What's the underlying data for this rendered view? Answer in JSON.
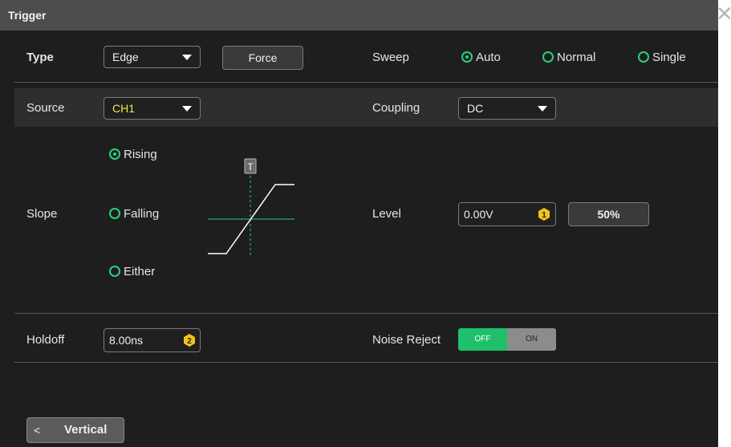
{
  "dialog": {
    "title": "Trigger",
    "close_icon": "close-icon"
  },
  "row_type": {
    "type_label": "Type",
    "type_value": "Edge",
    "force_label": "Force"
  },
  "sweep": {
    "label": "Sweep",
    "options": [
      {
        "label": "Auto",
        "selected": true
      },
      {
        "label": "Normal",
        "selected": false
      },
      {
        "label": "Single",
        "selected": false
      }
    ]
  },
  "source": {
    "label": "Source",
    "value": "CH1",
    "value_color": "#f5e642"
  },
  "coupling": {
    "label": "Coupling",
    "value": "DC"
  },
  "slope": {
    "label": "Slope",
    "options": [
      {
        "label": "Rising",
        "selected": true
      },
      {
        "label": "Falling",
        "selected": false
      },
      {
        "label": "Either",
        "selected": false
      }
    ],
    "marker_text": "T"
  },
  "level": {
    "label": "Level",
    "value": "0.00V",
    "knob_number": "1",
    "fifty_label": "50%"
  },
  "holdoff": {
    "label": "Holdoff",
    "value": "8.00ns",
    "knob_number": "2"
  },
  "noise_reject": {
    "label": "Noise Reject",
    "off_label": "OFF",
    "on_label": "ON",
    "state": "OFF"
  },
  "nav": {
    "back_label": "Vertical",
    "chevron": "<"
  },
  "colors": {
    "accent": "#2ad07a",
    "knob": "#f2c318",
    "panel": "#1e1e1e",
    "title_bar": "#4d4d4d"
  }
}
